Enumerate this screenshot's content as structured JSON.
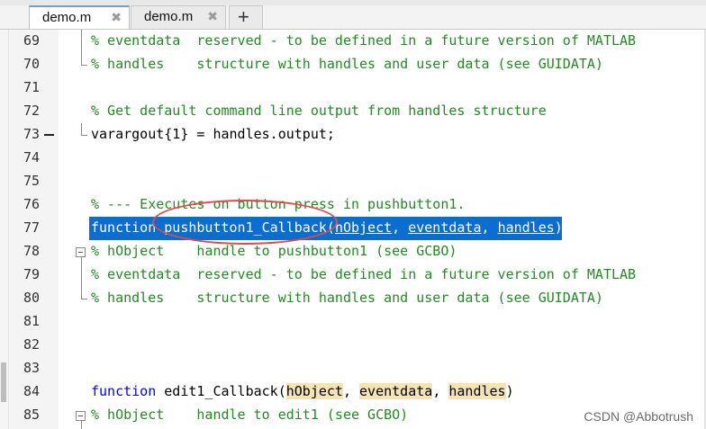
{
  "tabs": [
    {
      "label": "demo.m",
      "close": "✖",
      "active": true
    },
    {
      "label": "demo.m",
      "close": "✖",
      "active": false
    }
  ],
  "add_tab_label": "+",
  "colors": {
    "comment": "#228B22",
    "keyword": "#0000ff",
    "selection": "#0a6ed1",
    "param_highlight": "#f4e3b5",
    "annotation_ellipse": "#e04b4b"
  },
  "lines": [
    {
      "num": "69",
      "text": "% eventdata  reserved - to be defined in a future version of MATLAB"
    },
    {
      "num": "70",
      "text": "% handles    structure with handles and user data (see GUIDATA)"
    },
    {
      "num": "71",
      "text": ""
    },
    {
      "num": "72",
      "text": "% Get default command line output from handles structure"
    },
    {
      "num": "73",
      "text": "varargout{1} = handles.output;"
    },
    {
      "num": "74",
      "text": ""
    },
    {
      "num": "75",
      "text": ""
    },
    {
      "num": "76",
      "text": "% --- Executes on button press in pushbutton1."
    },
    {
      "num": "77",
      "keyword": "function",
      "name": "pushbutton1_Callback",
      "open": "(",
      "p1": "hObject",
      "sep1": ", ",
      "p2": "eventdata",
      "sep2": ", ",
      "p3": "handles",
      "close": ")"
    },
    {
      "num": "78",
      "text": "% hObject    handle to pushbutton1 (see GCBO)"
    },
    {
      "num": "79",
      "text": "% eventdata  reserved - to be defined in a future version of MATLAB"
    },
    {
      "num": "80",
      "text": "% handles    structure with handles and user data (see GUIDATA)"
    },
    {
      "num": "81",
      "text": ""
    },
    {
      "num": "82",
      "text": ""
    },
    {
      "num": "83",
      "text": ""
    },
    {
      "num": "84",
      "keyword": "function",
      "name": "edit1_Callback",
      "open": "(",
      "p1": "hObject",
      "sep1": ", ",
      "p2": "eventdata",
      "sep2": ", ",
      "p3": "handles",
      "close": ")"
    },
    {
      "num": "85",
      "text": "% hObject    handle to edit1 (see GCBO)"
    }
  ],
  "watermark": "CSDN @Abbotrush"
}
